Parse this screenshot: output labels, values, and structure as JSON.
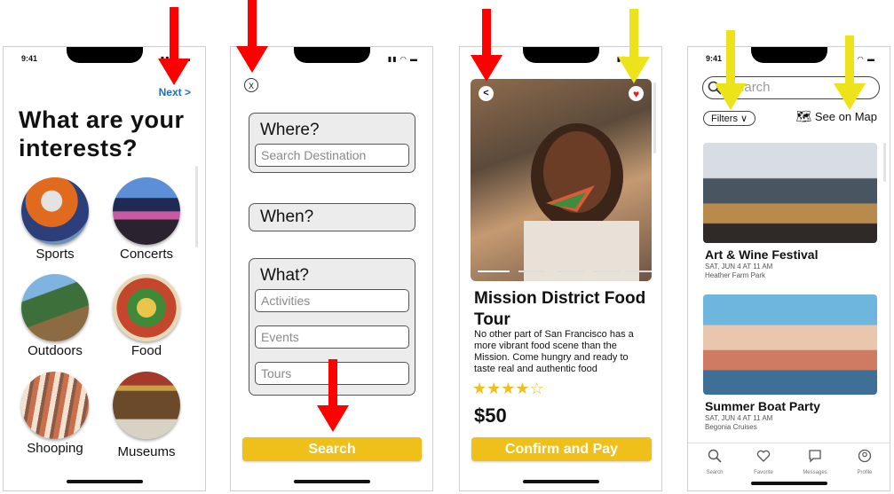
{
  "status": {
    "time": "9:41"
  },
  "screen1": {
    "next_label": "Next >",
    "title": "What are your interests?",
    "interests": [
      {
        "label": "Sports",
        "color": "#c86a2a"
      },
      {
        "label": "Concerts",
        "color": "#3a5ea8"
      },
      {
        "label": "Outdoors",
        "color": "#4f8c45"
      },
      {
        "label": "Food",
        "color": "#b2553a"
      },
      {
        "label": "Shooping",
        "color": "#c98b6d"
      },
      {
        "label": "Museums",
        "color": "#8a5b3a"
      }
    ]
  },
  "screen2": {
    "close_label": "X",
    "where_title": "Where?",
    "where_placeholder": "Search Destination",
    "when_title": "When?",
    "what_title": "What?",
    "what_options": [
      "Activities",
      "Events",
      "Tours"
    ],
    "search_label": "Search"
  },
  "screen3": {
    "back_label": "<",
    "title": "Mission District Food Tour",
    "description": "No other part of San Francisco has a more vibrant food scene than the Mission. Come hungry and ready to taste real and authentic food",
    "rating": 4,
    "rating_max": 5,
    "price": "$50",
    "confirm_label": "Confirm and Pay"
  },
  "screen4": {
    "search_placeholder": "Search",
    "filters_label": "Filters ∨",
    "map_label": "See on Map",
    "events": [
      {
        "title": "Art & Wine Festival",
        "date": "SAT, JUN 4 AT 11 AM",
        "place": "Heather Farm Park"
      },
      {
        "title": "Summer Boat Party",
        "date": "SAT, JUN 4 AT 11 AM",
        "place": "Begonia Cruises"
      }
    ],
    "tabs": [
      "Search",
      "Favorite",
      "Messages",
      "Profile"
    ]
  },
  "colors": {
    "accent_yellow": "#f0c01a",
    "arrow_red": "#ff0000",
    "arrow_yellow": "#ece31a",
    "link_blue": "#1d6fc4"
  }
}
